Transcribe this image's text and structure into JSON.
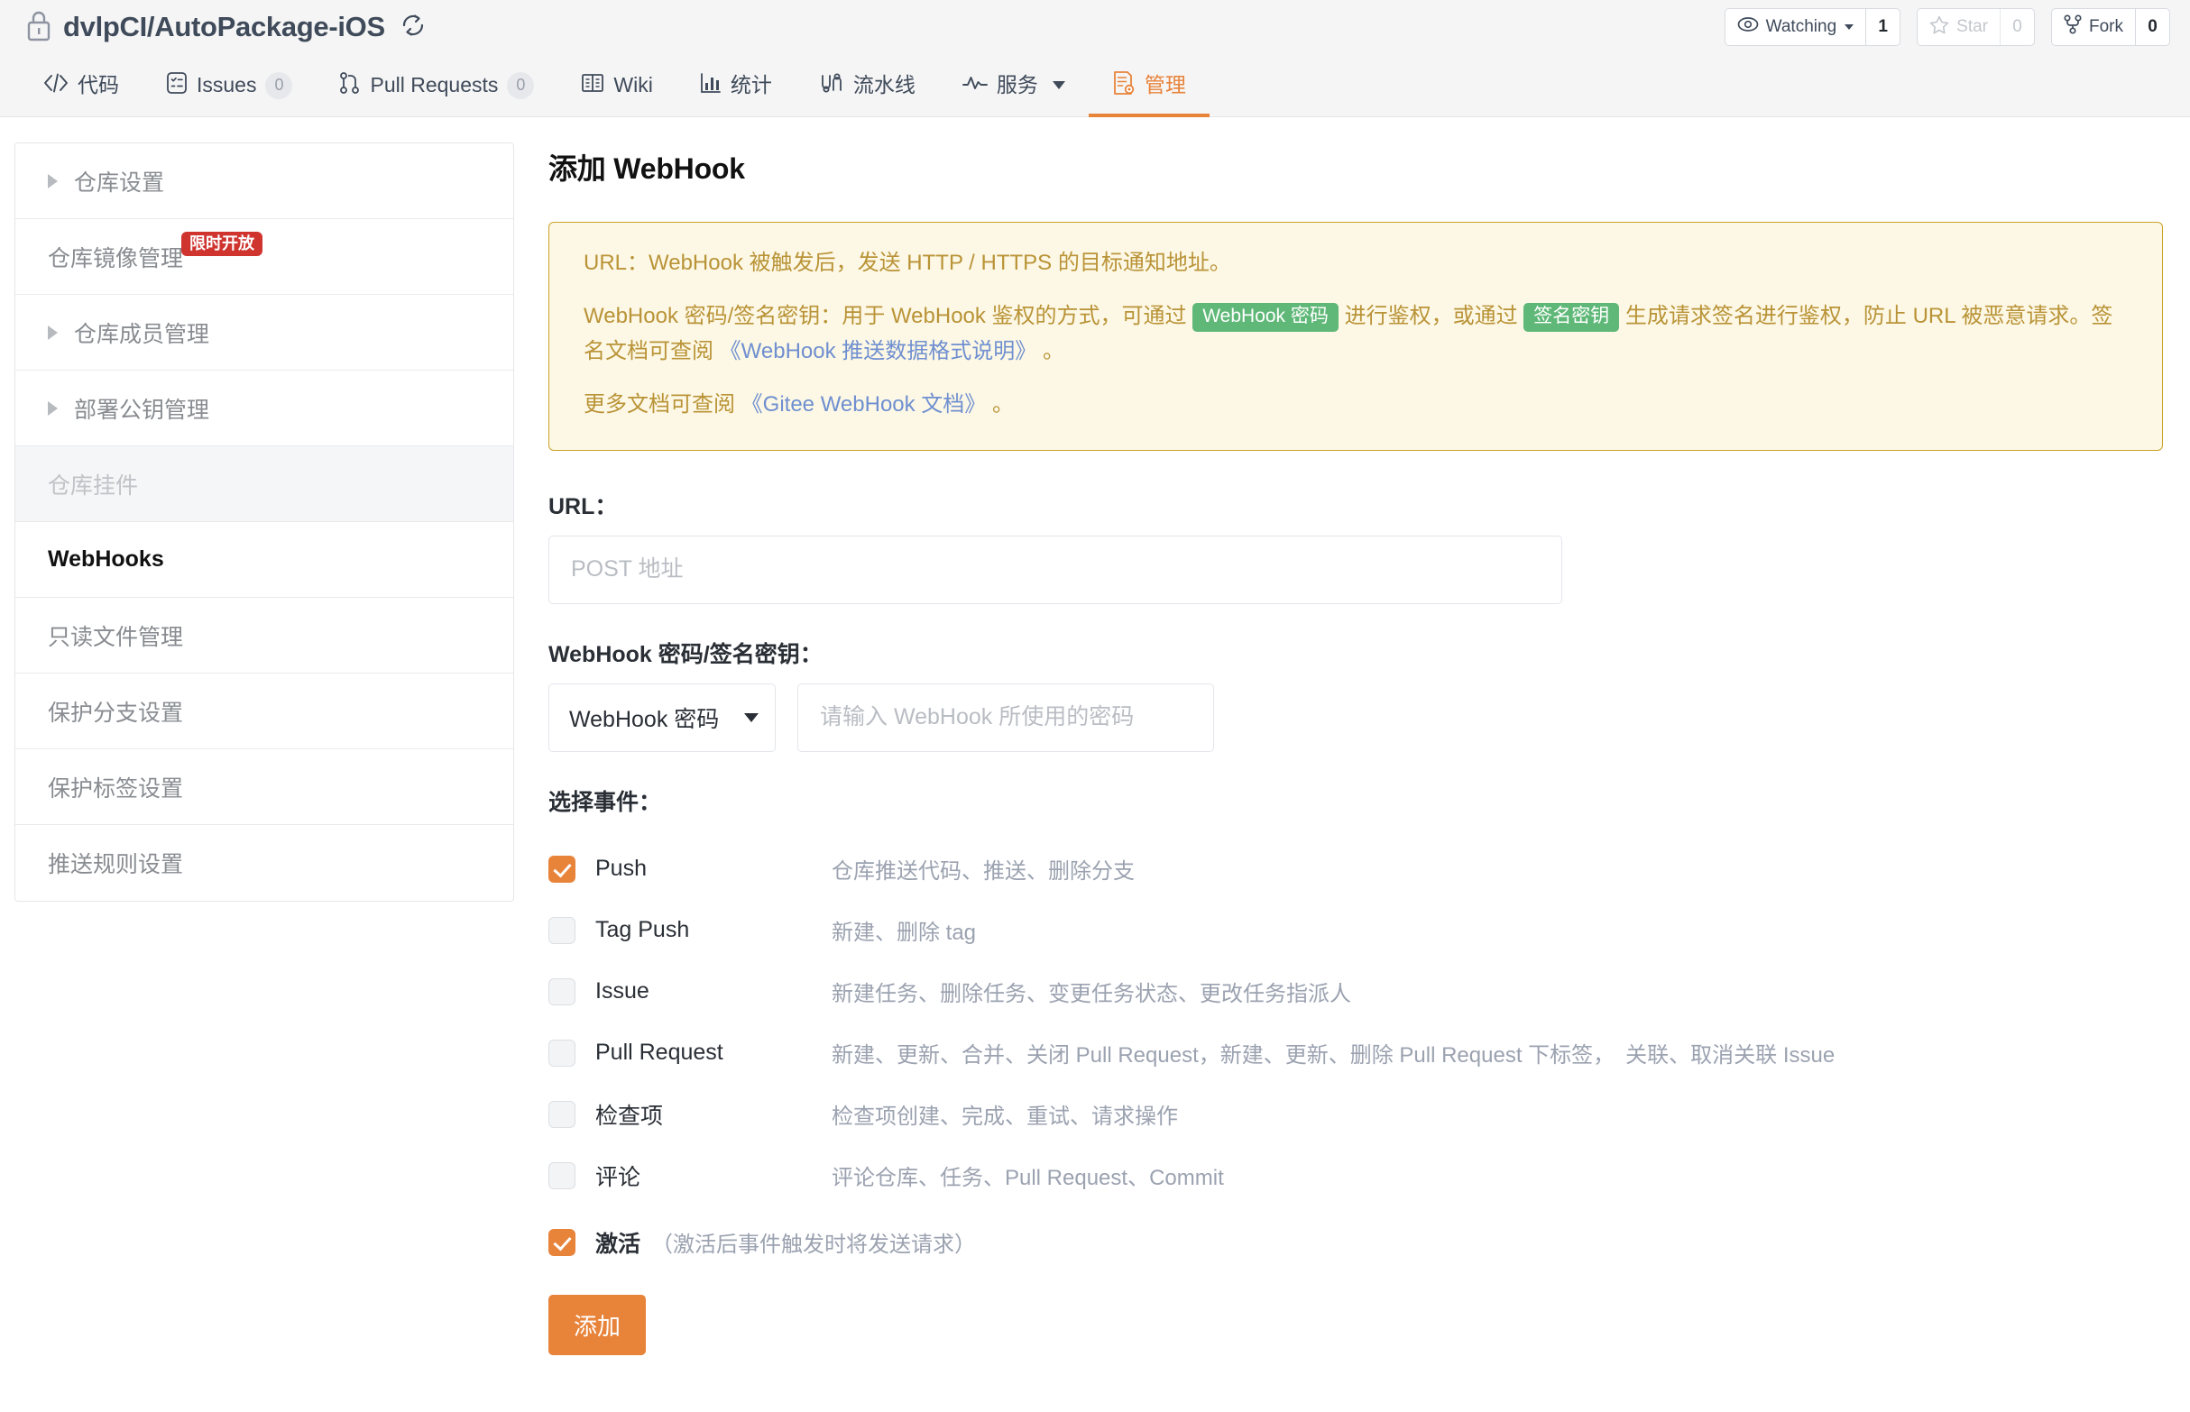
{
  "header": {
    "repo_name": "dvlpCI/AutoPackage-iOS",
    "lock_icon": "lock-icon",
    "refresh_icon": "sync-icon",
    "actions": [
      {
        "label": "Watching",
        "count": "1",
        "icon": "eye-icon",
        "has_caret": true,
        "muted": false
      },
      {
        "label": "Star",
        "count": "0",
        "icon": "star-icon",
        "has_caret": false,
        "muted": true
      },
      {
        "label": "Fork",
        "count": "0",
        "icon": "fork-icon",
        "has_caret": false,
        "muted": false
      }
    ]
  },
  "nav": {
    "tabs": [
      {
        "label": "代码",
        "icon": "code-icon",
        "badge": null,
        "active": false,
        "caret": false
      },
      {
        "label": "Issues",
        "icon": "issue-icon",
        "badge": "0",
        "active": false,
        "caret": false
      },
      {
        "label": "Pull Requests",
        "icon": "pull-request-icon",
        "badge": "0",
        "active": false,
        "caret": false
      },
      {
        "label": "Wiki",
        "icon": "book-icon",
        "badge": null,
        "active": false,
        "caret": false
      },
      {
        "label": "统计",
        "icon": "chart-icon",
        "badge": null,
        "active": false,
        "caret": false
      },
      {
        "label": "流水线",
        "icon": "pipeline-icon",
        "badge": null,
        "active": false,
        "caret": false
      },
      {
        "label": "服务",
        "icon": "activity-icon",
        "badge": null,
        "active": false,
        "caret": true
      },
      {
        "label": "管理",
        "icon": "settings-doc-icon",
        "badge": null,
        "active": true,
        "caret": false
      }
    ]
  },
  "sidebar": {
    "items": [
      {
        "label": "仓库设置",
        "arrow": true,
        "badge": null,
        "state": "normal"
      },
      {
        "label": "仓库镜像管理",
        "arrow": false,
        "badge": "限时开放",
        "state": "normal"
      },
      {
        "label": "仓库成员管理",
        "arrow": true,
        "badge": null,
        "state": "normal"
      },
      {
        "label": "部署公钥管理",
        "arrow": true,
        "badge": null,
        "state": "normal"
      },
      {
        "label": "仓库挂件",
        "arrow": false,
        "badge": null,
        "state": "disabled"
      },
      {
        "label": "WebHooks",
        "arrow": false,
        "badge": null,
        "state": "current"
      },
      {
        "label": "只读文件管理",
        "arrow": false,
        "badge": null,
        "state": "normal"
      },
      {
        "label": "保护分支设置",
        "arrow": false,
        "badge": null,
        "state": "normal"
      },
      {
        "label": "保护标签设置",
        "arrow": false,
        "badge": null,
        "state": "normal"
      },
      {
        "label": "推送规则设置",
        "arrow": false,
        "badge": null,
        "state": "normal"
      }
    ]
  },
  "main": {
    "page_title": "添加 WebHook",
    "notice": {
      "line1": "URL：WebHook 被触发后，发送 HTTP / HTTPS 的目标通知地址。",
      "line2_a": "WebHook 密码/签名密钥：用于 WebHook 鉴权的方式，可通过 ",
      "line2_tag1": "WebHook 密码",
      "line2_b": " 进行鉴权，或通过 ",
      "line2_tag2": "签名密钥",
      "line2_c": " 生成请求签名进行鉴权，防止 URL 被恶意请求。签名文档可查阅 ",
      "line2_link": "《WebHook 推送数据格式说明》",
      "line2_d": " 。",
      "line3_a": "更多文档可查阅 ",
      "line3_link": "《Gitee WebHook 文档》",
      "line3_b": " 。"
    },
    "url_field": {
      "label": "URL：",
      "placeholder": "POST 地址",
      "value": ""
    },
    "secret_field": {
      "label": "WebHook 密码/签名密钥：",
      "select_value": "WebHook 密码",
      "select_options": [
        "WebHook 密码",
        "签名密钥"
      ],
      "input_placeholder": "请输入 WebHook 所使用的密码",
      "input_value": ""
    },
    "events": {
      "label": "选择事件：",
      "items": [
        {
          "name": "Push",
          "desc": "仓库推送代码、推送、删除分支",
          "checked": true
        },
        {
          "name": "Tag Push",
          "desc": "新建、删除 tag",
          "checked": false
        },
        {
          "name": "Issue",
          "desc": "新建任务、删除任务、变更任务状态、更改任务指派人",
          "checked": false
        },
        {
          "name": "Pull Request",
          "desc": "新建、更新、合并、关闭 Pull Request，新建、更新、删除 Pull Request 下标签，　关联、取消关联 Issue",
          "checked": false
        },
        {
          "name": "检查项",
          "desc": "检查项创建、完成、重试、请求操作",
          "checked": false
        },
        {
          "name": "评论",
          "desc": "评论仓库、任务、Pull Request、Commit",
          "checked": false
        }
      ]
    },
    "activate": {
      "name": "激活",
      "hint": "（激活后事件触发时将发送请求）",
      "checked": true
    },
    "submit_label": "添加"
  },
  "colors": {
    "accent": "#e8833a",
    "notice_border": "#c9a227",
    "notice_bg": "#fdf8e5",
    "notice_text": "#b99337",
    "tag_green": "#5fb878",
    "link_blue": "#6f8fd0",
    "badge_red": "#cf342f"
  }
}
